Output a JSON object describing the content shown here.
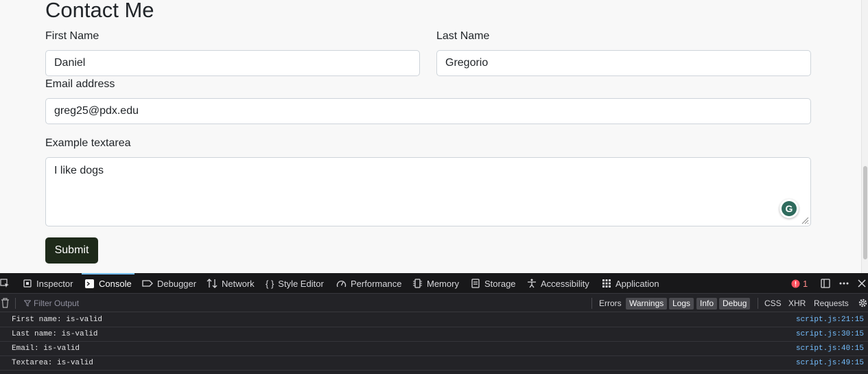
{
  "form": {
    "title": "Contact Me",
    "first_name_label": "First Name",
    "first_name_value": "Daniel",
    "last_name_label": "Last Name",
    "last_name_value": "Gregorio",
    "email_label": "Email address",
    "email_value": "greg25@pdx.edu",
    "textarea_label": "Example textarea",
    "textarea_value": "I like dogs",
    "submit_label": "Submit",
    "submit_color": "#1e2a1a",
    "grammarly_letter": "G"
  },
  "devtools": {
    "tabs": [
      {
        "label": "Inspector",
        "icon": "inspector-icon"
      },
      {
        "label": "Console",
        "icon": "console-icon",
        "active": true
      },
      {
        "label": "Debugger",
        "icon": "debugger-icon"
      },
      {
        "label": "Network",
        "icon": "network-icon"
      },
      {
        "label": "Style Editor",
        "icon": "style-editor-icon"
      },
      {
        "label": "Performance",
        "icon": "performance-icon"
      },
      {
        "label": "Memory",
        "icon": "memory-icon"
      },
      {
        "label": "Storage",
        "icon": "storage-icon"
      },
      {
        "label": "Accessibility",
        "icon": "accessibility-icon"
      },
      {
        "label": "Application",
        "icon": "application-icon"
      }
    ],
    "error_count": "1",
    "filter_placeholder": "Filter Output",
    "filters": {
      "errors": "Errors",
      "warnings": "Warnings",
      "logs": "Logs",
      "info": "Info",
      "debug": "Debug",
      "css": "CSS",
      "xhr": "XHR",
      "requests": "Requests"
    },
    "messages": [
      {
        "text": "First name: is-valid",
        "source": "script.js:21:15"
      },
      {
        "text": "Last name: is-valid",
        "source": "script.js:30:15"
      },
      {
        "text": "Email: is-valid",
        "source": "script.js:40:15"
      },
      {
        "text": "Textarea: is-valid",
        "source": "script.js:49:15"
      }
    ],
    "accent_color": "#75bfff"
  }
}
